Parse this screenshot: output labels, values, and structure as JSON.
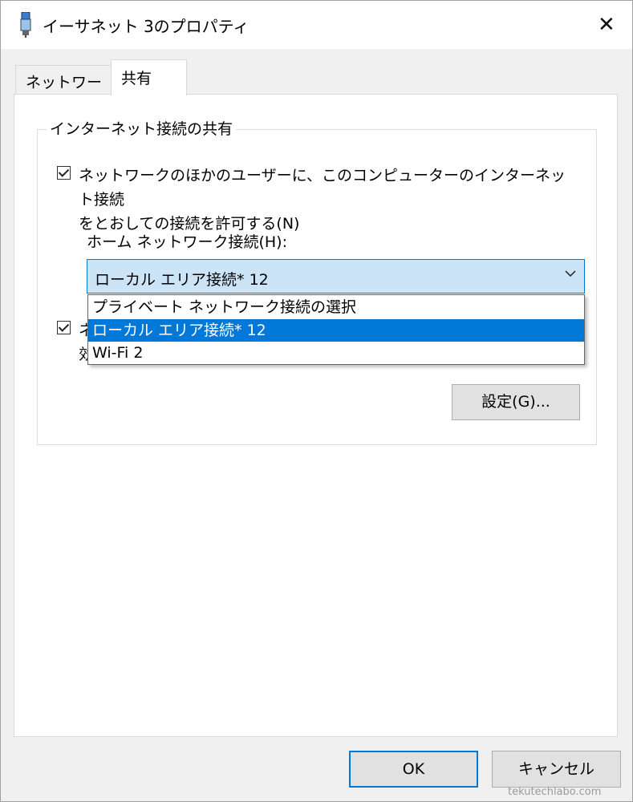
{
  "window": {
    "title": "イーサネット 3のプロパティ",
    "icon": "network-adapter-icon",
    "close_glyph": "✕"
  },
  "tabs": [
    {
      "label": "ネットワーク",
      "selected": false
    },
    {
      "label": "共有",
      "selected": true
    }
  ],
  "sharing": {
    "group_title": "インターネット接続の共有",
    "allow_checkbox": {
      "checked": true,
      "label_line1": "ネットワークのほかのユーザーに、このコンピューターのインターネット接続",
      "label_line2": "をとおしての接続を許可する(N)"
    },
    "home_network_label": "ホーム ネットワーク接続(H):",
    "home_network_select": {
      "value": "ローカル エリア接続* 12",
      "options": [
        "プライベート ネットワーク接続の選択",
        "ローカル エリア接続* 12",
        "Wi-Fi 2"
      ],
      "highlighted_index": 1
    },
    "second_checkbox": {
      "checked": true,
      "label_line1_visible": "ネ",
      "label_line2_visible": "効"
    },
    "settings_button": "設定(G)..."
  },
  "footer": {
    "ok_label": "OK",
    "cancel_label": "キャンセル"
  },
  "watermark": "tekutechlabo.com",
  "colors": {
    "accent": "#0078d7",
    "combo_bg": "#cce4f7",
    "panel_bg": "#ffffff",
    "window_bg": "#f0f0f0"
  }
}
